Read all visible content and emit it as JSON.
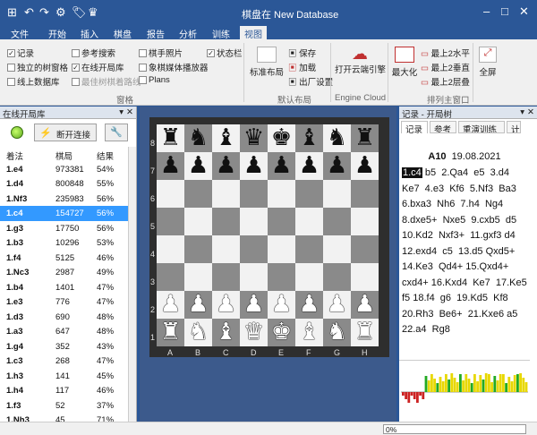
{
  "window": {
    "title": "棋盘在 New Database"
  },
  "quick_access": [
    "↶",
    "↷",
    "⚙",
    "🏷",
    "♛"
  ],
  "tabs": [
    "文件",
    "开始",
    "插入",
    "棋盘",
    "报告",
    "分析",
    "训练",
    "视图"
  ],
  "ribbon": {
    "checkboxes": [
      {
        "label": "记录",
        "checked": true
      },
      {
        "label": "独立的树窗格",
        "checked": false
      },
      {
        "label": "线上数据库",
        "checked": false
      },
      {
        "label": "参考搜索",
        "checked": false
      },
      {
        "label": "在线开局库",
        "checked": true
      },
      {
        "label": "最佳树棋着路线",
        "checked": false
      },
      {
        "label": "棋手照片",
        "checked": false
      },
      {
        "label": "象棋媒体播放器",
        "checked": false
      },
      {
        "label": "Plans",
        "checked": false
      },
      {
        "label": "状态栏",
        "checked": true
      }
    ],
    "panes_group": "窗格",
    "layout_btn": "标准布局",
    "save_btn": "保存",
    "load_btn": "加载",
    "factory_btn": "出厂设置",
    "layout_group": "默认布局",
    "cloud_btn": "打开云端引擎",
    "cloud_group": "Engine Cloud",
    "max_btn": "最大化",
    "top2h": "最上2水平",
    "top2v": "最上2垂直",
    "top2l": "最上2层叠",
    "arrange_group": "排列主窗口",
    "full_btn": "全屏"
  },
  "left_panel": {
    "title": "在线开局库",
    "connect_btn": "断开连接",
    "columns": [
      "着法",
      "棋局",
      "结果"
    ],
    "rows": [
      [
        "1.e4",
        "973381",
        "54%"
      ],
      [
        "1.d4",
        "800848",
        "55%"
      ],
      [
        "1.Nf3",
        "235983",
        "56%"
      ],
      [
        "1.c4",
        "154727",
        "56%"
      ],
      [
        "1.g3",
        "17750",
        "56%"
      ],
      [
        "1.b3",
        "10296",
        "53%"
      ],
      [
        "1.f4",
        "5125",
        "46%"
      ],
      [
        "1.Nc3",
        "2987",
        "49%"
      ],
      [
        "1.b4",
        "1401",
        "47%"
      ],
      [
        "1.e3",
        "776",
        "47%"
      ],
      [
        "1.d3",
        "690",
        "48%"
      ],
      [
        "1.a3",
        "647",
        "48%"
      ],
      [
        "1.g4",
        "352",
        "43%"
      ],
      [
        "1.c3",
        "268",
        "47%"
      ],
      [
        "1.h3",
        "141",
        "45%"
      ],
      [
        "1.h4",
        "117",
        "46%"
      ],
      [
        "1.f3",
        "52",
        "37%"
      ],
      [
        "1.Nh3",
        "45",
        "71%"
      ]
    ]
  },
  "board": {
    "files": [
      "A",
      "B",
      "C",
      "D",
      "E",
      "F",
      "G",
      "H"
    ],
    "ranks": [
      "8",
      "7",
      "6",
      "5",
      "4",
      "3",
      "2",
      "1"
    ],
    "position": [
      [
        "♜",
        "♞",
        "♝",
        "♛",
        "♚",
        "♝",
        "♞",
        "♜"
      ],
      [
        "♟",
        "♟",
        "♟",
        "♟",
        "♟",
        "♟",
        "♟",
        "♟"
      ],
      [
        "",
        "",
        "",
        "",
        "",
        "",
        "",
        ""
      ],
      [
        "",
        "",
        "",
        "",
        "",
        "",
        "",
        ""
      ],
      [
        "",
        "",
        "",
        "",
        "",
        "",
        "",
        ""
      ],
      [
        "",
        "",
        "",
        "",
        "",
        "",
        "",
        ""
      ],
      [
        "♟",
        "♟",
        "♟",
        "♟",
        "♟",
        "♟",
        "♟",
        "♟"
      ],
      [
        "♜",
        "♞",
        "♝",
        "♛",
        "♚",
        "♝",
        "♞",
        "♜"
      ]
    ]
  },
  "right_panel": {
    "title": "记录 - 开局树",
    "tabs": [
      "记录",
      "参考",
      "重演训练",
      "计"
    ],
    "game_eco": "A10",
    "game_date": "19.08.2021",
    "first_move": "1.c4",
    "moves_rest": " b5  2.Qa4  e5  3.d4 Ke7  4.e3  Kf6  5.Nf3  Ba3 6.bxa3  Nh6  7.h4  Ng4 8.dxe5+  Nxe5  9.cxb5  d5 10.Kd2  Nxf3+  11.gxf3 d4  12.exd4  c5  13.d5 Qxd5+  14.Ke3  Qd4+ 15.Qxd4+  cxd4+ 16.Kxd4  Ke7  17.Ke5  f5 18.f4  g6  19.Kd5  Kf8 20.Rh3  Be6+  21.Kxe6 a5  22.a4  Rg8"
  },
  "status": {
    "progress_text": "0%"
  },
  "colors": {
    "accent": "#2b5797",
    "selection": "#3399ff"
  }
}
